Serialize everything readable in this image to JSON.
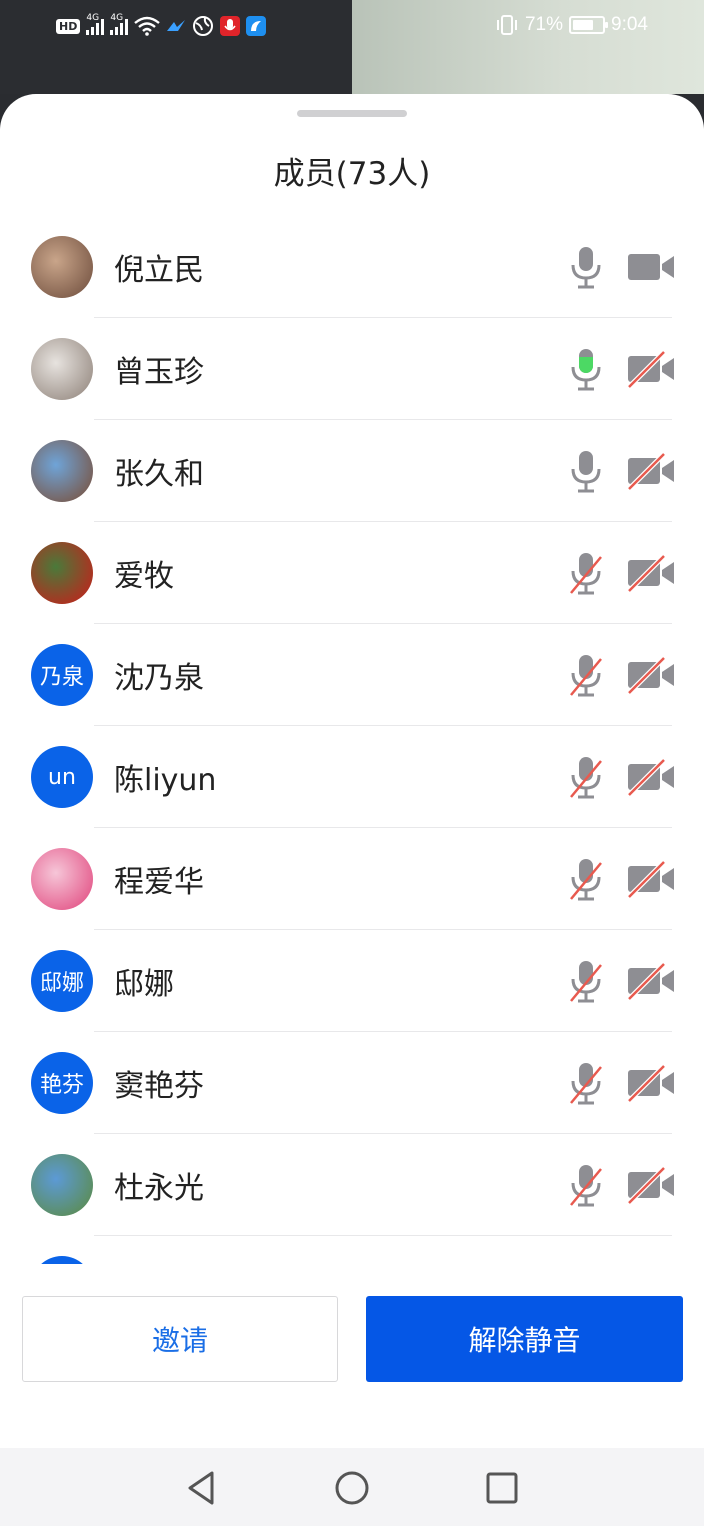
{
  "status_bar": {
    "hd_label": "HD",
    "signal1_label": "4G",
    "signal2_label": "4G",
    "battery_percent": "71%",
    "battery_level": 0.71,
    "time": "9:04"
  },
  "sheet": {
    "title": "成员(73人)"
  },
  "members": [
    {
      "name": "倪立民",
      "avatar_text": "",
      "avatar_colors": [
        "#c9a58a",
        "#6b4a3a"
      ],
      "mic": "on",
      "mic_speaking": false,
      "camera": "on"
    },
    {
      "name": "曾玉珍",
      "avatar_text": "",
      "avatar_colors": [
        "#e7e3df",
        "#8c7f76"
      ],
      "mic": "on",
      "mic_speaking": true,
      "camera": "off"
    },
    {
      "name": "张久和",
      "avatar_text": "",
      "avatar_colors": [
        "#6fa4d8",
        "#7a4a30"
      ],
      "mic": "on",
      "mic_speaking": false,
      "camera": "off"
    },
    {
      "name": "爱牧",
      "avatar_text": "",
      "avatar_colors": [
        "#4a7a3a",
        "#d01818"
      ],
      "mic": "off",
      "mic_speaking": false,
      "camera": "off"
    },
    {
      "name": "沈乃泉",
      "avatar_text": "乃泉",
      "avatar_colors": [
        "#0a63e8",
        "#0a63e8"
      ],
      "mic": "off",
      "mic_speaking": false,
      "camera": "off"
    },
    {
      "name": "陈liyun",
      "avatar_text": "un",
      "avatar_colors": [
        "#0a63e8",
        "#0a63e8"
      ],
      "mic": "off",
      "mic_speaking": false,
      "camera": "off"
    },
    {
      "name": "程爱华",
      "avatar_text": "",
      "avatar_colors": [
        "#f6c6d8",
        "#e0427a"
      ],
      "mic": "off",
      "mic_speaking": false,
      "camera": "off"
    },
    {
      "name": "邸娜",
      "avatar_text": "邸娜",
      "avatar_colors": [
        "#0a63e8",
        "#0a63e8"
      ],
      "mic": "off",
      "mic_speaking": false,
      "camera": "off"
    },
    {
      "name": "窦艳芬",
      "avatar_text": "艳芬",
      "avatar_colors": [
        "#0a63e8",
        "#0a63e8"
      ],
      "mic": "off",
      "mic_speaking": false,
      "camera": "off"
    },
    {
      "name": "杜永光",
      "avatar_text": "",
      "avatar_colors": [
        "#5c9ad6",
        "#5b8a3a"
      ],
      "mic": "off",
      "mic_speaking": false,
      "camera": "off"
    },
    {
      "name": "",
      "avatar_text": "",
      "avatar_colors": [
        "#0a63e8",
        "#0a63e8"
      ],
      "mic": "off",
      "mic_speaking": false,
      "camera": "off"
    }
  ],
  "buttons": {
    "invite_label": "邀请",
    "unmute_label": "解除静音"
  },
  "colors": {
    "accent": "#0557e6",
    "icon_gray": "#8e8e93",
    "muted_red": "#e85a4f",
    "speaking_green": "#4cd964"
  }
}
